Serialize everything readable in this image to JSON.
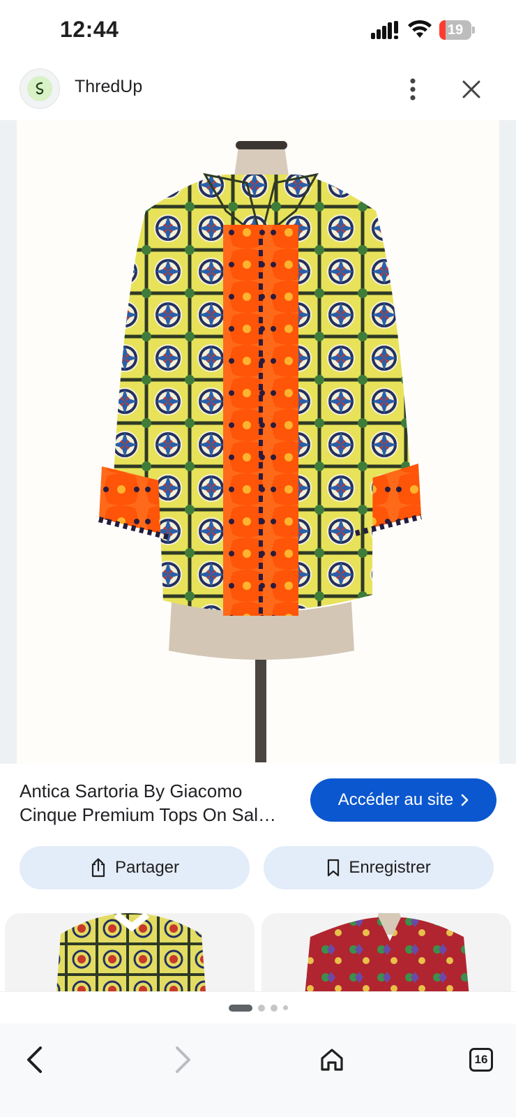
{
  "status_bar": {
    "time": "12:44",
    "battery_level": "19",
    "battery_fraction": 0.19
  },
  "header": {
    "site_name": "ThredUp",
    "logo_icon": "thredup-logo-icon",
    "more_icon": "more-vert-icon",
    "close_icon": "close-icon"
  },
  "product": {
    "title": "Antica Sartoria By Giacomo Cinque Premium Tops On Sal…",
    "image_icon": "shirt-on-mannequin"
  },
  "buttons": {
    "visit_label": "Accéder au site",
    "share_label": "Partager",
    "save_label": "Enregistrer"
  },
  "pager": {
    "pages": 4,
    "active": 0
  },
  "nav": {
    "tab_count": "16"
  },
  "colors": {
    "accent": "#0b57d0",
    "chip_bg": "#e3ecf9",
    "shirt_yellow": "#e7e25a",
    "shirt_orange": "#ff5a12",
    "shirt_navy": "#23305e"
  }
}
